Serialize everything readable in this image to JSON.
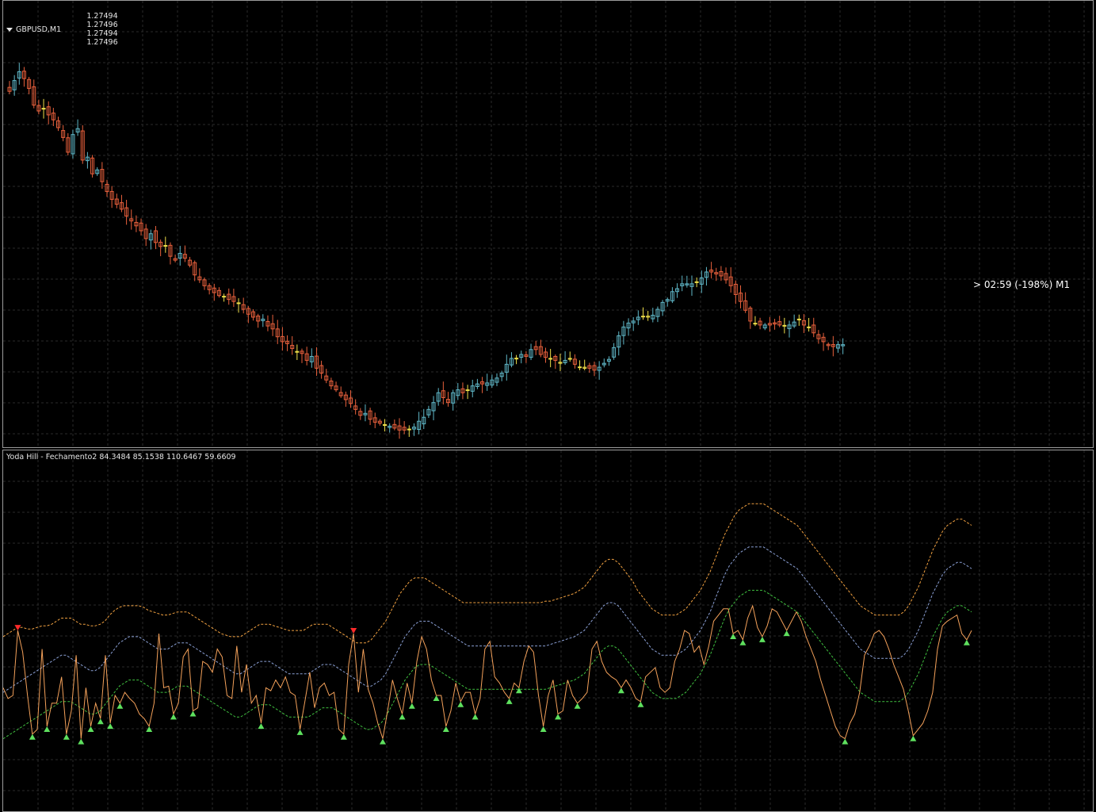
{
  "main_chart": {
    "symbol": "GBPUSD,M1",
    "ohlc": [
      "1.27494",
      "1.27496",
      "1.27494",
      "1.27496"
    ],
    "countdown_label": "> 02:59 (-198%) M1",
    "up_color": "#5fb7c7",
    "down_color": "#e8603c",
    "doji_color": "#f0e04a",
    "grid_color": "#2a2a2a",
    "closes": [
      68,
      57,
      48,
      55,
      65,
      82,
      88,
      86,
      92,
      97,
      105,
      115,
      130,
      112,
      106,
      138,
      135,
      152,
      148,
      160,
      170,
      178,
      183,
      188,
      195,
      200,
      205,
      210,
      218,
      213,
      222,
      226,
      225,
      236,
      240,
      233,
      238,
      245,
      255,
      260,
      266,
      270,
      273,
      276,
      277,
      280,
      282,
      284,
      290,
      295,
      298,
      302,
      300,
      307,
      310,
      318,
      323,
      325,
      330,
      333,
      335,
      342,
      338,
      350,
      355,
      362,
      368,
      372,
      378,
      382,
      386,
      392,
      398,
      396,
      402,
      405,
      406,
      408,
      409,
      411,
      413,
      413,
      412,
      410,
      404,
      400,
      392,
      385,
      375,
      380,
      385,
      375,
      372,
      375,
      372,
      368,
      366,
      366,
      365,
      362,
      360,
      355,
      346,
      340,
      340,
      336,
      338,
      331,
      331,
      336,
      339,
      340,
      342,
      344,
      342,
      340,
      346,
      349,
      349,
      350,
      352,
      349,
      345,
      341,
      329,
      317,
      308,
      304,
      302,
      298,
      297,
      298,
      296,
      290,
      283,
      280,
      272,
      269,
      264,
      264,
      264,
      262,
      258,
      252,
      252,
      254,
      256,
      260,
      266,
      275,
      282,
      291,
      302,
      305,
      306,
      306,
      306,
      305,
      306,
      307,
      306,
      303,
      300,
      306,
      308,
      314,
      320,
      323,
      327,
      328,
      326,
      326
    ]
  },
  "indicator": {
    "header": "Yoda Hill - Fechamento2 84.3484 85.1538 110.6467 59.6609",
    "main_color": "#f4a15a",
    "upper_color": "#f0a040",
    "middle_color": "#8a9fd4",
    "lower_color": "#3fbf3f",
    "buy_arrow_color": "#5ee05e",
    "sell_arrow_color": "#ff2a2a",
    "main_line": [
      45,
      38,
      40,
      82,
      68,
      40,
      15,
      18,
      70,
      20,
      35,
      35,
      52,
      15,
      30,
      66,
      12,
      45,
      20,
      35,
      25,
      66,
      22,
      40,
      35,
      42,
      38,
      35,
      28,
      25,
      20,
      35,
      80,
      45,
      46,
      28,
      35,
      65,
      70,
      30,
      32,
      62,
      60,
      55,
      70,
      65,
      40,
      38,
      72,
      42,
      60,
      35,
      40,
      22,
      45,
      43,
      50,
      45,
      52,
      42,
      40,
      18,
      36,
      55,
      32,
      45,
      48,
      40,
      42,
      18,
      15,
      60,
      80,
      42,
      70,
      44,
      35,
      22,
      12,
      30,
      50,
      38,
      28,
      48,
      35,
      62,
      78,
      70,
      50,
      40,
      40,
      20,
      30,
      48,
      36,
      42,
      42,
      28,
      38,
      70,
      75,
      52,
      48,
      42,
      38,
      48,
      45,
      62,
      72,
      68,
      40,
      20,
      40,
      50,
      28,
      30,
      50,
      40,
      35,
      38,
      42,
      70,
      75,
      62,
      55,
      52,
      50,
      45,
      50,
      45,
      38,
      36,
      52,
      55,
      58,
      45,
      42,
      45,
      62,
      70,
      82,
      80,
      68,
      72,
      60,
      72,
      88,
      92,
      96,
      96,
      80,
      82,
      76,
      90,
      98,
      84,
      78,
      85,
      96,
      94,
      88,
      82,
      88,
      94,
      88,
      78,
      70,
      62,
      50,
      40,
      30,
      20,
      14,
      12,
      22,
      28,
      42,
      66,
      72,
      80,
      82,
      78,
      70,
      60,
      52,
      44,
      30,
      14,
      18,
      22,
      30,
      42,
      70,
      85,
      88,
      90,
      92,
      80,
      76,
      82
    ],
    "upper_band": [
      78,
      80,
      82,
      84,
      84,
      83,
      83,
      84,
      85,
      85,
      86,
      88,
      90,
      90,
      90,
      88,
      86,
      86,
      85,
      85,
      86,
      88,
      92,
      95,
      97,
      98,
      98,
      98,
      98,
      97,
      95,
      94,
      93,
      92,
      92,
      93,
      94,
      94,
      94,
      92,
      90,
      88,
      86,
      84,
      82,
      80,
      79,
      78,
      78,
      78,
      80,
      82,
      84,
      86,
      86,
      86,
      85,
      84,
      83,
      82,
      82,
      82,
      82,
      84,
      86,
      86,
      86,
      86,
      84,
      82,
      80,
      78,
      76,
      74,
      74,
      74,
      76,
      80,
      84,
      88,
      94,
      100,
      106,
      110,
      114,
      116,
      116,
      116,
      114,
      112,
      110,
      108,
      106,
      104,
      102,
      100,
      100,
      100,
      100,
      100,
      100,
      100,
      100,
      100,
      100,
      100,
      100,
      100,
      100,
      100,
      100,
      100,
      101,
      101,
      102,
      103,
      104,
      105,
      106,
      108,
      110,
      114,
      118,
      122,
      126,
      128,
      128,
      126,
      122,
      118,
      114,
      108,
      104,
      100,
      96,
      94,
      92,
      92,
      92,
      92,
      94,
      96,
      100,
      104,
      108,
      114,
      120,
      128,
      136,
      144,
      150,
      156,
      160,
      162,
      164,
      164,
      164,
      164,
      162,
      160,
      158,
      156,
      154,
      152,
      150,
      146,
      142,
      138,
      134,
      130,
      126,
      122,
      118,
      114,
      110,
      106,
      102,
      98,
      96,
      94,
      92,
      92,
      92,
      92,
      92,
      92,
      94,
      98,
      104,
      110,
      118,
      126,
      134,
      140,
      146,
      150,
      152,
      154,
      154,
      152,
      150
    ],
    "middle_band": [
      42,
      44,
      46,
      48,
      50,
      52,
      54,
      56,
      58,
      60,
      62,
      64,
      66,
      66,
      64,
      62,
      60,
      58,
      56,
      56,
      58,
      62,
      66,
      70,
      74,
      76,
      78,
      78,
      78,
      76,
      74,
      72,
      70,
      70,
      70,
      72,
      74,
      74,
      74,
      72,
      70,
      68,
      66,
      64,
      62,
      60,
      58,
      56,
      54,
      54,
      56,
      58,
      60,
      62,
      62,
      62,
      60,
      58,
      56,
      54,
      54,
      54,
      54,
      54,
      56,
      58,
      60,
      60,
      60,
      58,
      56,
      54,
      52,
      50,
      48,
      46,
      46,
      48,
      50,
      54,
      60,
      66,
      72,
      78,
      82,
      86,
      88,
      88,
      88,
      86,
      84,
      82,
      80,
      78,
      76,
      74,
      72,
      72,
      72,
      72,
      72,
      72,
      72,
      72,
      72,
      72,
      72,
      72,
      72,
      72,
      72,
      72,
      72,
      73,
      74,
      75,
      76,
      77,
      78,
      80,
      82,
      86,
      90,
      94,
      98,
      100,
      100,
      98,
      94,
      90,
      86,
      82,
      78,
      74,
      70,
      68,
      66,
      66,
      66,
      66,
      68,
      70,
      74,
      78,
      82,
      88,
      94,
      102,
      110,
      118,
      124,
      128,
      132,
      134,
      136,
      136,
      136,
      136,
      134,
      132,
      130,
      128,
      126,
      124,
      122,
      118,
      114,
      110,
      106,
      102,
      98,
      94,
      90,
      86,
      82,
      78,
      74,
      70,
      68,
      66,
      64,
      64,
      64,
      64,
      64,
      64,
      66,
      70,
      76,
      82,
      90,
      98,
      106,
      112,
      118,
      122,
      124,
      126,
      126,
      124,
      122
    ],
    "lower_band": [
      12,
      14,
      16,
      18,
      20,
      22,
      24,
      26,
      28,
      30,
      32,
      34,
      36,
      36,
      36,
      34,
      32,
      30,
      28,
      28,
      30,
      34,
      38,
      42,
      46,
      48,
      50,
      50,
      50,
      48,
      46,
      44,
      42,
      42,
      42,
      44,
      46,
      46,
      46,
      44,
      42,
      40,
      38,
      36,
      34,
      32,
      30,
      28,
      26,
      26,
      28,
      30,
      32,
      34,
      34,
      34,
      32,
      30,
      28,
      26,
      26,
      26,
      26,
      26,
      28,
      30,
      32,
      32,
      32,
      30,
      28,
      26,
      24,
      22,
      20,
      18,
      18,
      20,
      22,
      26,
      32,
      38,
      44,
      50,
      54,
      58,
      60,
      60,
      60,
      58,
      56,
      54,
      52,
      50,
      48,
      46,
      44,
      44,
      44,
      44,
      44,
      44,
      44,
      44,
      44,
      44,
      44,
      44,
      44,
      44,
      44,
      44,
      44,
      45,
      46,
      47,
      48,
      49,
      50,
      52,
      54,
      58,
      62,
      66,
      70,
      72,
      72,
      70,
      66,
      62,
      58,
      54,
      50,
      46,
      42,
      40,
      38,
      38,
      38,
      38,
      40,
      42,
      46,
      50,
      54,
      60,
      66,
      74,
      82,
      90,
      96,
      100,
      104,
      106,
      108,
      108,
      108,
      108,
      106,
      104,
      102,
      100,
      98,
      96,
      94,
      90,
      86,
      82,
      78,
      74,
      70,
      66,
      62,
      58,
      54,
      50,
      46,
      42,
      40,
      38,
      36,
      36,
      36,
      36,
      36,
      36,
      38,
      42,
      48,
      54,
      62,
      70,
      78,
      84,
      90,
      94,
      96,
      98,
      98,
      96,
      94
    ]
  }
}
